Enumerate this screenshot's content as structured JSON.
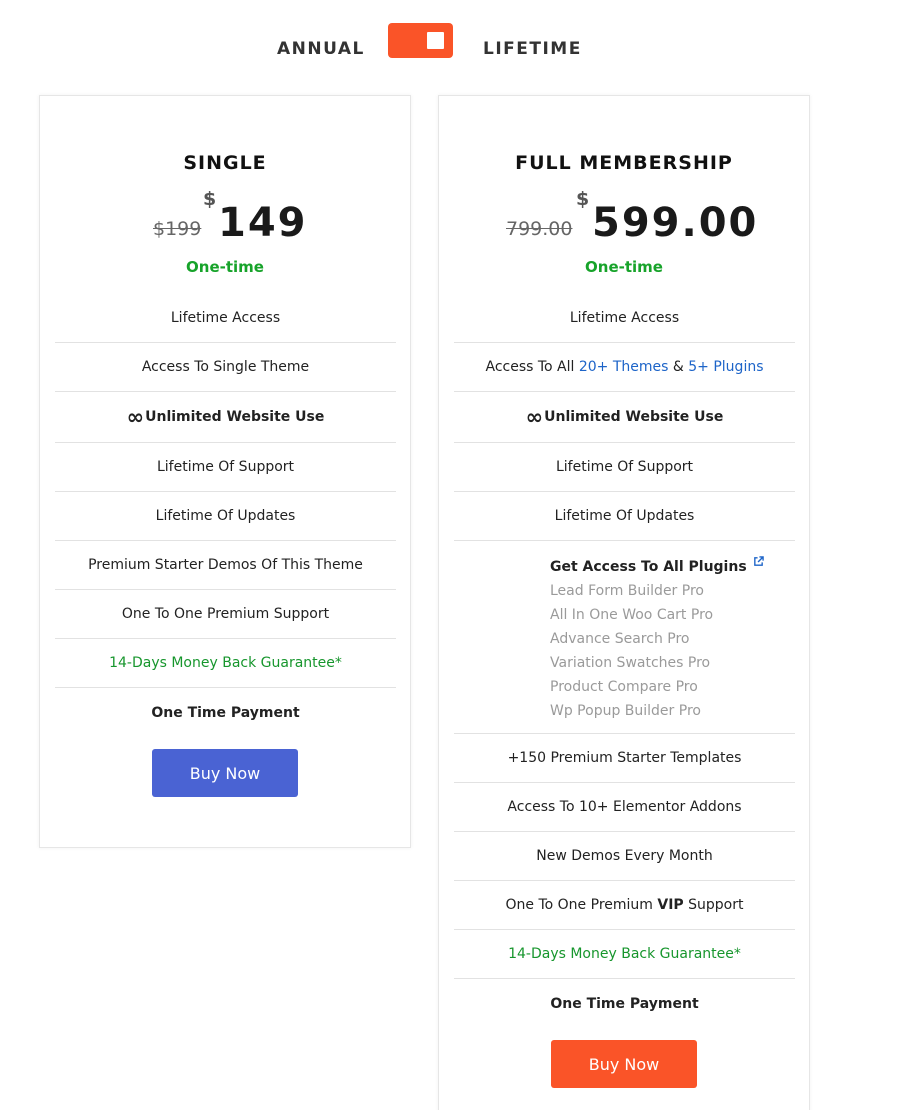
{
  "toggle": {
    "left_label": "ANNUAL",
    "right_label": "LIFETIME",
    "state": "lifetime",
    "accent_color": "#fa5428"
  },
  "plans": [
    {
      "title": "SINGLE",
      "old_price": "$199",
      "currency": "$",
      "price": "149",
      "billing": "One-time",
      "features": [
        "Lifetime Access",
        "Access To Single Theme",
        "Unlimited Website Use",
        "Lifetime Of Support",
        "Lifetime Of Updates",
        "Premium Starter Demos Of This Theme",
        "One To One Premium Support",
        "14-Days Money Back Guarantee*",
        "One Time Payment"
      ],
      "button": {
        "label": "Buy Now",
        "color": "#4a63d3"
      }
    },
    {
      "title": "FULL MEMBERSHIP",
      "old_price": "799.00",
      "currency": "$",
      "price": "599.00",
      "billing": "One-time",
      "features_top": {
        "lifetime_access": "Lifetime Access",
        "access_prefix": "Access To All ",
        "themes_link": "20+ Themes",
        "amp": " & ",
        "plugins_link": "5+ Plugins",
        "unlimited": "Unlimited Website Use",
        "support": "Lifetime Of Support",
        "updates": "Lifetime Of Updates"
      },
      "plugins": {
        "title": "Get Access To All Plugins",
        "items": [
          "Lead Form Builder Pro",
          "All In One Woo Cart Pro",
          "Advance Search Pro",
          "Variation Swatches Pro",
          "Product Compare Pro",
          "Wp Popup Builder Pro"
        ]
      },
      "features_bottom": {
        "templates": "+150 Premium Starter Templates",
        "addons": "Access To 10+ Elementor Addons",
        "demos": "New Demos Every Month",
        "vip_prefix": "One To One Premium ",
        "vip_bold": "VIP",
        "vip_suffix": " Support",
        "guarantee": "14-Days Money Back Guarantee*",
        "payment": "One Time Payment"
      },
      "button": {
        "label": "Buy Now",
        "color": "#fa5428"
      }
    }
  ],
  "colors": {
    "green": "#17a32a",
    "link": "#1d64c8",
    "muted": "#9a9a9a"
  }
}
